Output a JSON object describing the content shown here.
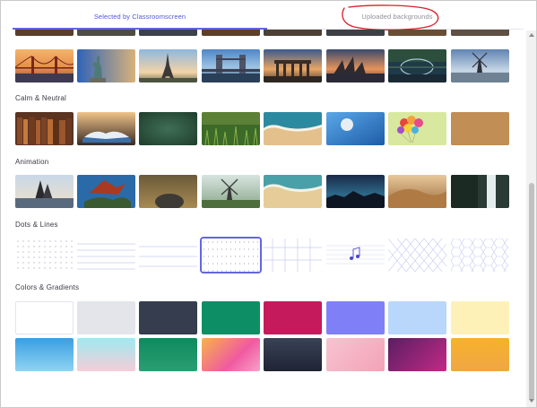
{
  "tabs": {
    "classroomscreen": "Selected by Classroomscreen",
    "uploaded": "Uploaded backgrounds"
  },
  "sections": {
    "calm": "Calm & Neutral",
    "animation": "Animation",
    "dots": "Dots & Lines",
    "colors": "Colors & Gradients"
  },
  "colors": {
    "accent": "#6164e2",
    "annotation": "#d81f2a",
    "tab_text": "#8f8f99"
  }
}
